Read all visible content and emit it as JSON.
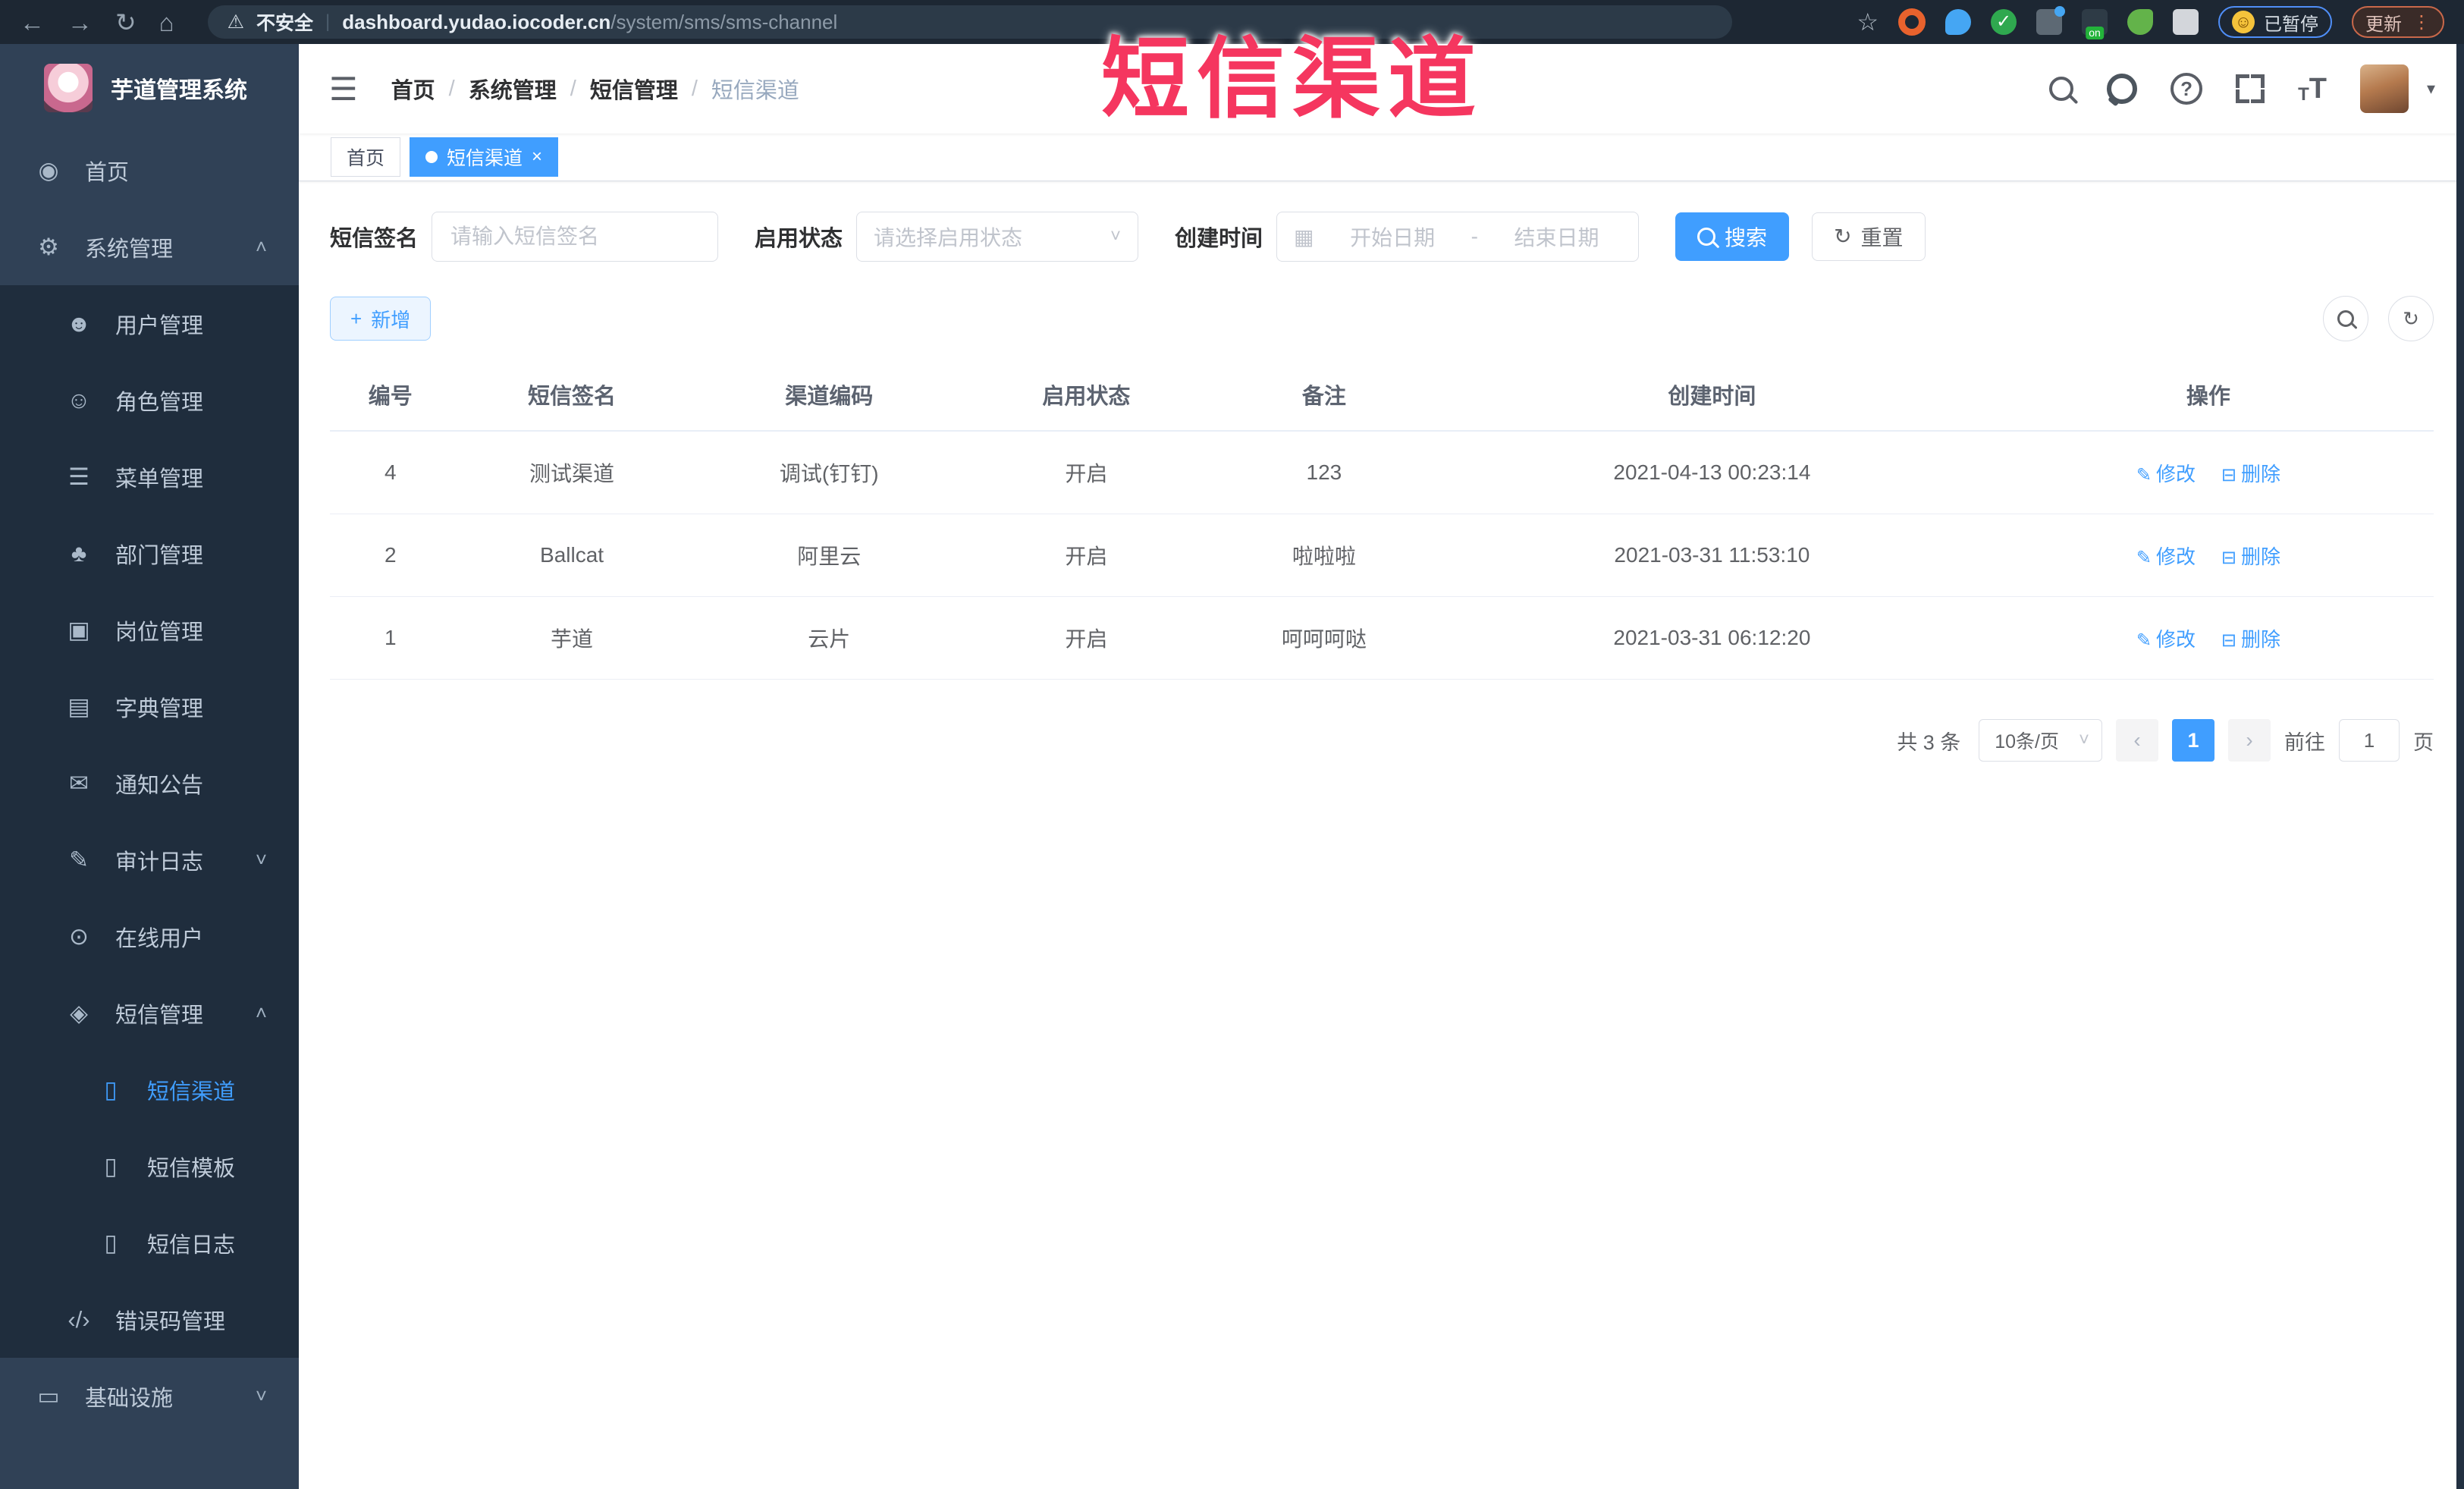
{
  "browser": {
    "back_glyph": "←",
    "forward_glyph": "→",
    "reload_glyph": "↻",
    "home_glyph": "⌂",
    "warning_glyph": "⚠",
    "security_text": "不安全",
    "separator": "|",
    "url_host": "dashboard.yudao.iocoder.cn",
    "url_path": "/system/sms/sms-channel",
    "star_glyph": "☆",
    "check_glyph": "✓",
    "on_badge": "on",
    "face_glyph": "☺",
    "paused_label": "已暂停",
    "update_label": "更新",
    "menu_dots": "⋮"
  },
  "watermark": "短信渠道",
  "sidebar": {
    "logo_title": "芋道管理系统",
    "items": [
      {
        "label": "首页",
        "glyph": "◉",
        "level": 0,
        "active": false,
        "arrow_glyph": ""
      },
      {
        "label": "系统管理",
        "glyph": "⚙",
        "level": 0,
        "active": false,
        "arrow_glyph": "˄"
      },
      {
        "label": "用户管理",
        "glyph": "☻",
        "level": 1,
        "active": false,
        "arrow_glyph": ""
      },
      {
        "label": "角色管理",
        "glyph": "☺",
        "level": 1,
        "active": false,
        "arrow_glyph": ""
      },
      {
        "label": "菜单管理",
        "glyph": "☰",
        "level": 1,
        "active": false,
        "arrow_glyph": ""
      },
      {
        "label": "部门管理",
        "glyph": "♣",
        "level": 1,
        "active": false,
        "arrow_glyph": ""
      },
      {
        "label": "岗位管理",
        "glyph": "▣",
        "level": 1,
        "active": false,
        "arrow_glyph": ""
      },
      {
        "label": "字典管理",
        "glyph": "▤",
        "level": 1,
        "active": false,
        "arrow_glyph": ""
      },
      {
        "label": "通知公告",
        "glyph": "✉",
        "level": 1,
        "active": false,
        "arrow_glyph": ""
      },
      {
        "label": "审计日志",
        "glyph": "✎",
        "level": 1,
        "active": false,
        "arrow_glyph": "˅"
      },
      {
        "label": "在线用户",
        "glyph": "⊙",
        "level": 1,
        "active": false,
        "arrow_glyph": ""
      },
      {
        "label": "短信管理",
        "glyph": "◈",
        "level": 1,
        "active": false,
        "arrow_glyph": "˄"
      },
      {
        "label": "短信渠道",
        "glyph": "▯",
        "level": 2,
        "active": true,
        "arrow_glyph": ""
      },
      {
        "label": "短信模板",
        "glyph": "▯",
        "level": 2,
        "active": false,
        "arrow_glyph": ""
      },
      {
        "label": "短信日志",
        "glyph": "▯",
        "level": 2,
        "active": false,
        "arrow_glyph": ""
      },
      {
        "label": "错误码管理",
        "glyph": "‹/›",
        "level": 1,
        "active": false,
        "arrow_glyph": ""
      },
      {
        "label": "基础设施",
        "glyph": "▭",
        "level": 0,
        "active": false,
        "arrow_glyph": "˅"
      }
    ]
  },
  "header": {
    "hamburger_glyph": "☰",
    "breadcrumb": [
      "首页",
      "系统管理",
      "短信管理",
      "短信渠道"
    ],
    "breadcrumb_separator": "/",
    "help_glyph": "?",
    "font_icon_small": "T",
    "font_icon_big": "T",
    "caret_glyph": "▾"
  },
  "tabs": {
    "home": {
      "label": "首页"
    },
    "current": {
      "label": "短信渠道",
      "close_glyph": "×"
    }
  },
  "filters": {
    "sign_label": "短信签名",
    "sign_placeholder": "请输入短信签名",
    "status_label": "启用状态",
    "status_placeholder": "请选择启用状态",
    "time_label": "创建时间",
    "calendar_glyph": "▦",
    "date_start_placeholder": "开始日期",
    "date_separator": "-",
    "date_end_placeholder": "结束日期",
    "select_caret_glyph": "˅",
    "search_label": "搜索",
    "reset_label": "重置",
    "reset_glyph": "↻"
  },
  "toolbar": {
    "add_plus_glyph": "+",
    "add_label": "新增",
    "refresh_glyph": "↻"
  },
  "table": {
    "columns": [
      "编号",
      "短信签名",
      "渠道编码",
      "启用状态",
      "备注",
      "创建时间",
      "操作"
    ],
    "rows": [
      {
        "id": "4",
        "sign": "测试渠道",
        "code": "调试(钉钉)",
        "status": "开启",
        "remark": "123",
        "created": "2021-04-13 00:23:14"
      },
      {
        "id": "2",
        "sign": "Ballcat",
        "code": "阿里云",
        "status": "开启",
        "remark": "啦啦啦",
        "created": "2021-03-31 11:53:10"
      },
      {
        "id": "1",
        "sign": "芋道",
        "code": "云片",
        "status": "开启",
        "remark": "呵呵呵哒",
        "created": "2021-03-31 06:12:20"
      }
    ],
    "edit_icon_glyph": "✎",
    "edit_label": "修改",
    "delete_icon_glyph": "⊟",
    "delete_label": "删除"
  },
  "pagination": {
    "total_text": "共 3 条",
    "page_size": "10条/页",
    "size_caret_glyph": "˅",
    "prev_glyph": "‹",
    "current_page": "1",
    "next_glyph": "›",
    "goto_label": "前往",
    "goto_value": "1",
    "page_suffix": "页"
  },
  "colors": {
    "accent": "#409eff",
    "sidebar_bg": "#304156",
    "submenu_bg": "#1f2d3d",
    "sidebar_text": "#bfcbd9",
    "watermark_red": "#f5365f",
    "chrome_bg": "#1d2733",
    "table_border": "#ebeef5",
    "add_button_bg": "#ecf5ff"
  }
}
